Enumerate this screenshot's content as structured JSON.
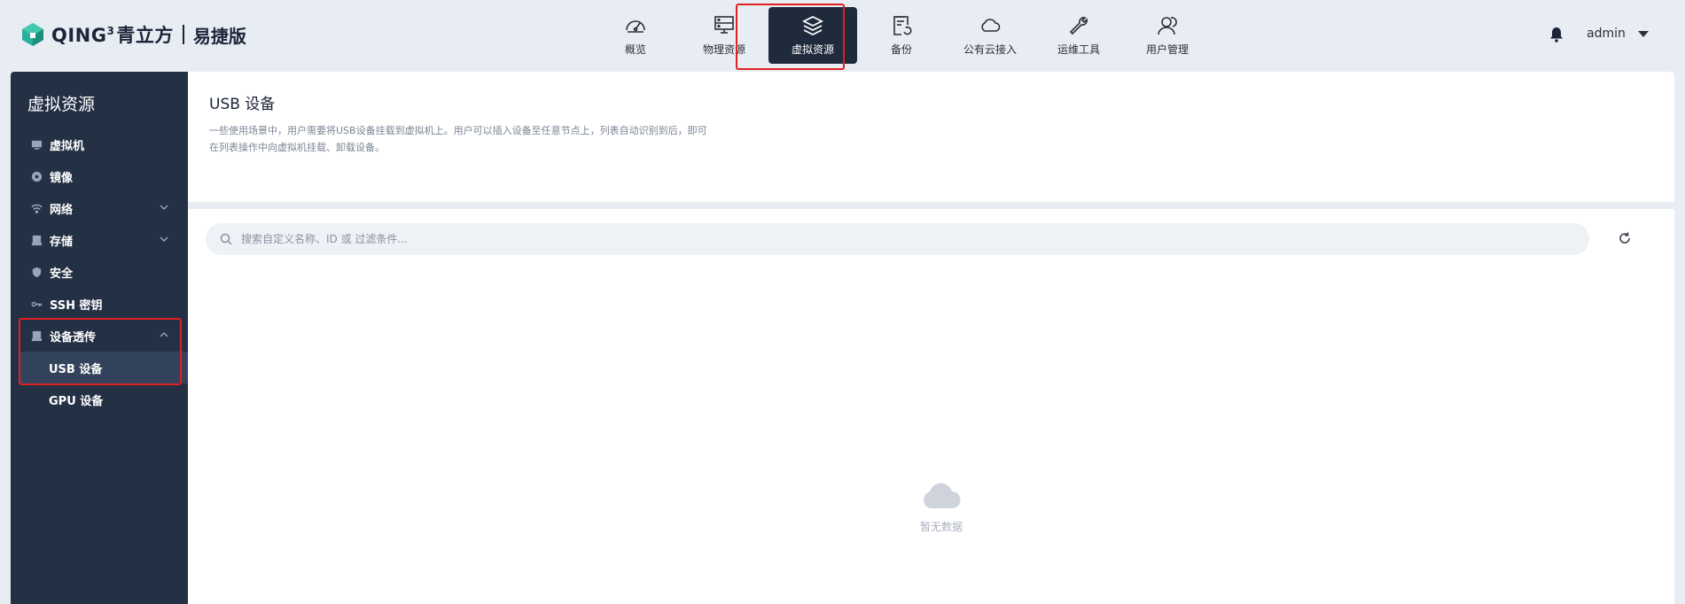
{
  "brand": {
    "name": "QING",
    "sup": "3",
    "name_cn": "青立方",
    "edition": "易捷版",
    "accent": "#27b199"
  },
  "topnav": [
    {
      "label": "概览",
      "icon": "gauge-icon"
    },
    {
      "label": "物理资源",
      "icon": "server-icon"
    },
    {
      "label": "虚拟资源",
      "icon": "layers-icon",
      "active": true
    },
    {
      "label": "备份",
      "icon": "backup-icon"
    },
    {
      "label": "公有云接入",
      "icon": "cloud-icon"
    },
    {
      "label": "运维工具",
      "icon": "wrench-icon"
    },
    {
      "label": "用户管理",
      "icon": "users-icon"
    }
  ],
  "user": {
    "name": "admin"
  },
  "annotations": {
    "box1": "1",
    "box2": "2"
  },
  "sidebar": {
    "title": "虚拟资源",
    "items": [
      {
        "label": "虚拟机",
        "icon": "monitor-icon"
      },
      {
        "label": "镜像",
        "icon": "disc-icon"
      },
      {
        "label": "网络",
        "icon": "wifi-icon",
        "expandable": true
      },
      {
        "label": "存储",
        "icon": "storage-icon",
        "expandable": true
      },
      {
        "label": "安全",
        "icon": "shield-icon"
      },
      {
        "label": "SSH 密钥",
        "icon": "key-icon"
      },
      {
        "label": "设备透传",
        "icon": "device-icon",
        "expanded": true
      }
    ],
    "sub_items": [
      {
        "label": "USB 设备",
        "active": true
      },
      {
        "label": "GPU 设备"
      }
    ]
  },
  "page": {
    "title": "USB 设备",
    "description": "一些使用场景中，用户需要将USB设备挂载到虚拟机上。用户可以插入设备至任意节点上，列表自动识别到后，即可在列表操作中向虚拟机挂载、卸载设备。"
  },
  "search": {
    "placeholder": "搜索自定义名称、ID 或 过滤条件..."
  },
  "empty": {
    "text": "暂无数据"
  },
  "colors": {
    "header_bg": "#e8edf3",
    "sidebar_bg": "#243044",
    "active_nav_bg": "#1f2a3d",
    "annotation": "#e02020"
  }
}
